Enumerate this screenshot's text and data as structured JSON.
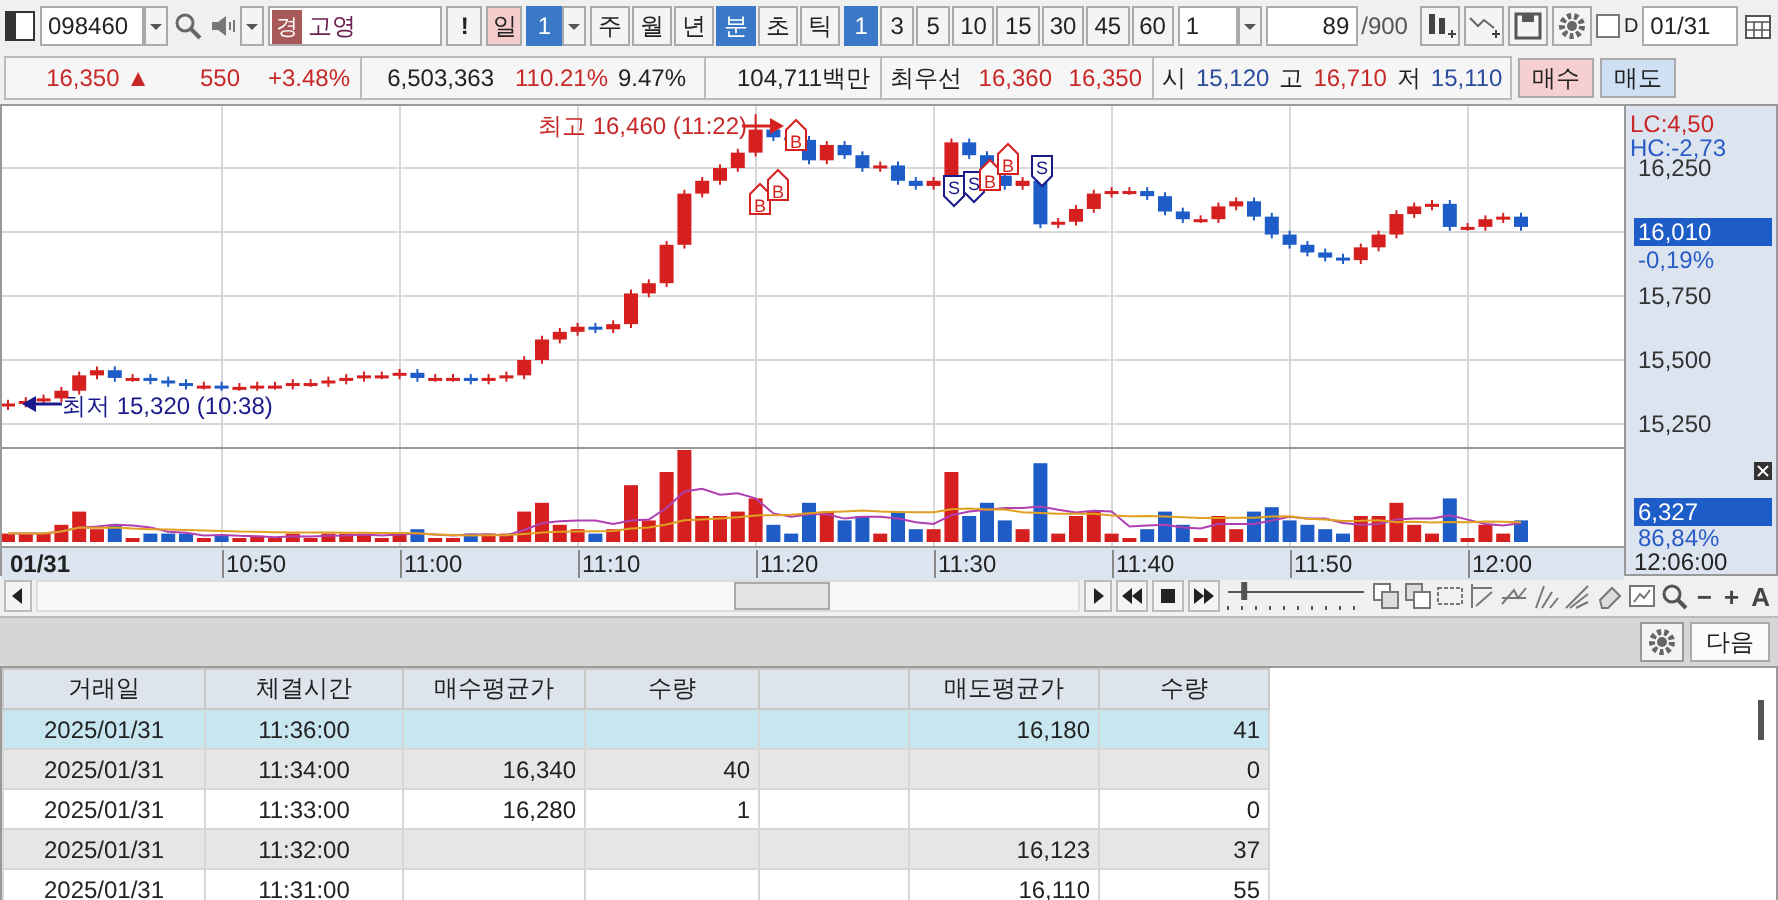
{
  "toolbar": {
    "code": "098460",
    "market_badge": "경",
    "name": "고영",
    "alert": "!",
    "day": {
      "label": "일",
      "count": "1"
    },
    "periods": [
      {
        "label": "주",
        "selected": false
      },
      {
        "label": "월",
        "selected": false
      },
      {
        "label": "년",
        "selected": false
      },
      {
        "label": "분",
        "selected": true
      },
      {
        "label": "초",
        "selected": false
      },
      {
        "label": "틱",
        "selected": false
      }
    ],
    "intervals": [
      {
        "label": "1",
        "selected": true
      },
      {
        "label": "3",
        "selected": false
      },
      {
        "label": "5",
        "selected": false
      },
      {
        "label": "10",
        "selected": false
      },
      {
        "label": "15",
        "selected": false
      },
      {
        "label": "30",
        "selected": false
      },
      {
        "label": "45",
        "selected": false
      },
      {
        "label": "60",
        "selected": false
      }
    ],
    "bar_count": "1",
    "shown": "89",
    "total": "/900",
    "d_checked": false,
    "d_label": "D",
    "date": "01/31"
  },
  "quote": {
    "price": "16,350",
    "direction": "▲",
    "change": "550",
    "change_rate": "+3.48%",
    "volume": "6,503,363",
    "volume_ratio": "110.21%",
    "turnover": "9.47%",
    "amount": "104,711백만",
    "best_label": "최우선",
    "best_ask": "16,360",
    "best_bid": "16,350",
    "open_label": "시",
    "open": "15,120",
    "high_label": "고",
    "high": "16,710",
    "low_label": "저",
    "low": "15,110",
    "buy": "매수",
    "sell": "매도"
  },
  "chart": {
    "high_note": "최고 16,460 (11:22)",
    "low_note": "최저 15,320 (10:38)",
    "markers": [
      {
        "kind": "buy",
        "label": "B"
      },
      {
        "kind": "buy",
        "label": "B"
      },
      {
        "kind": "buy",
        "label": "B"
      },
      {
        "kind": "sell",
        "label": "S"
      },
      {
        "kind": "sell",
        "label": "S"
      },
      {
        "kind": "buy",
        "label": "B"
      },
      {
        "kind": "buy",
        "label": "B"
      },
      {
        "kind": "sell",
        "label": "S"
      }
    ],
    "lc": "LC:4,50",
    "hc": "HC:-2,73",
    "price_ticks": [
      "16,250",
      "15,750",
      "15,500",
      "15,250"
    ],
    "current_price": "16,010",
    "current_change": "-0,19%",
    "volume_current": "6,327",
    "volume_ratio": "86,84%",
    "date": "01/31",
    "time_ticks": [
      "10:50",
      "11:00",
      "11:10",
      "11:20",
      "11:30",
      "11:40",
      "11:50",
      "12:00"
    ],
    "end_time": "12:06:00"
  },
  "nav": {
    "speed_slider": {
      "level": 0.1
    },
    "glyphs": [
      "−",
      "+",
      "A"
    ]
  },
  "panel": {
    "next": "다음"
  },
  "table": {
    "columns": [
      "거래일",
      "체결시간",
      "매수평균가",
      "수량",
      "",
      "매도평균가",
      "수량"
    ],
    "rows": [
      {
        "selected": true,
        "cells": [
          "2025/01/31",
          "11:36:00",
          "",
          "",
          "",
          "16,180",
          "41"
        ]
      },
      {
        "selected": false,
        "cells": [
          "2025/01/31",
          "11:34:00",
          "16,340",
          "40",
          "",
          "",
          "0"
        ]
      },
      {
        "selected": false,
        "cells": [
          "2025/01/31",
          "11:33:00",
          "16,280",
          "1",
          "",
          "",
          "0"
        ]
      },
      {
        "selected": false,
        "cells": [
          "2025/01/31",
          "11:32:00",
          "",
          "",
          "",
          "16,123",
          "37"
        ]
      },
      {
        "selected": false,
        "cells": [
          "2025/01/31",
          "11:31:00",
          "",
          "",
          "",
          "16,110",
          "55"
        ]
      }
    ]
  }
}
